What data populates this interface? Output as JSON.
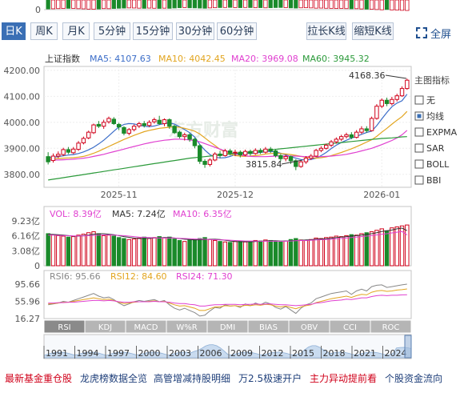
{
  "top_strip_label": "0",
  "tabs": [
    "日K",
    "周K",
    "月K",
    "5分钟",
    "15分钟",
    "30分钟",
    "60分钟"
  ],
  "buttons": {
    "stretch": "拉长K线",
    "shrink": "缩短K线",
    "fullscreen": "全屏"
  },
  "main": {
    "index_name": "上证指数",
    "ma": [
      {
        "label": "MA5: 4107.63",
        "color": "#3b6dc8"
      },
      {
        "label": "MA10: 4042.45",
        "color": "#e2a51f"
      },
      {
        "label": "MA20: 3969.08",
        "color": "#e040d0"
      },
      {
        "label": "MA60: 3945.32",
        "color": "#2b9a3a"
      }
    ],
    "y_ticks": [
      "4200.00",
      "4100.00",
      "4000.00",
      "3900.00",
      "3800.00"
    ],
    "x_ticks": [
      "2025-11",
      "2025-12",
      "2026-01"
    ],
    "high_label": "4168.36",
    "low_label": "3815.84",
    "watermark": "东方财富"
  },
  "indicators": {
    "title": "主图指标",
    "options": [
      {
        "label": "无",
        "checked": false
      },
      {
        "label": "均线",
        "checked": true
      },
      {
        "label": "EXPMA",
        "checked": false
      },
      {
        "label": "SAR",
        "checked": false
      },
      {
        "label": "BOLL",
        "checked": false
      },
      {
        "label": "BBI",
        "checked": false
      }
    ]
  },
  "volume": {
    "labels": [
      {
        "text": "VOL: 8.39亿",
        "color": "#e040d0"
      },
      {
        "text": "MA5: 7.24亿",
        "color": "#333333"
      },
      {
        "text": "MA10: 6.35亿",
        "color": "#e040d0"
      }
    ],
    "y_ticks": [
      "9.23亿",
      "6.16亿",
      "3.08亿",
      "0"
    ]
  },
  "rsi": {
    "labels": [
      {
        "text": "RSI6: 95.66",
        "color": "#888888"
      },
      {
        "text": "RSI12: 84.60",
        "color": "#e2a51f"
      },
      {
        "text": "RSI24: 71.30",
        "color": "#e040d0"
      }
    ],
    "y_ticks": [
      "95.66",
      "55.96",
      "16.27"
    ]
  },
  "indicator_tabs": [
    "RSI",
    "KDJ",
    "MACD",
    "W%R",
    "DMI",
    "BIAS",
    "OBV",
    "CCI",
    "ROC"
  ],
  "timeline_years": [
    "1991",
    "1994",
    "1997",
    "2000",
    "2003",
    "2006",
    "2009",
    "2012",
    "2015",
    "2018",
    "2021",
    "2024"
  ],
  "bottom_links": [
    {
      "label": "最新基金重仓股",
      "color": "#d0021b"
    },
    {
      "label": "龙虎榜数据全览",
      "color": "#1f3f7a"
    },
    {
      "label": "高管增减持股明细",
      "color": "#1f3f7a"
    },
    {
      "label": "万2.5极速开户",
      "color": "#1f3f7a"
    },
    {
      "label": "主力异动提前看",
      "color": "#d0021b"
    },
    {
      "label": "个股资金流向",
      "color": "#1f3f7a"
    }
  ],
  "colors": {
    "up": "#d0021b",
    "down": "#1a8a2a",
    "accent": "#3a6fb5"
  },
  "chart_data": {
    "type": "candlestick",
    "title": "上证指数",
    "ylim": [
      3750,
      4215
    ],
    "candles": [
      [
        3868,
        3848,
        3885,
        3838
      ],
      [
        3853,
        3870,
        3880,
        3845
      ],
      [
        3870,
        3877,
        3888,
        3862
      ],
      [
        3876,
        3895,
        3902,
        3870
      ],
      [
        3895,
        3885,
        3905,
        3878
      ],
      [
        3883,
        3897,
        3905,
        3878
      ],
      [
        3896,
        3920,
        3928,
        3890
      ],
      [
        3921,
        3938,
        3945,
        3915
      ],
      [
        3940,
        3962,
        3968,
        3935
      ],
      [
        3960,
        3990,
        3995,
        3955
      ],
      [
        3992,
        3985,
        4005,
        3978
      ],
      [
        3985,
        4000,
        4010,
        3975
      ],
      [
        4002,
        4015,
        4022,
        3995
      ],
      [
        4012,
        3995,
        4020,
        3990
      ],
      [
        3992,
        3982,
        3998,
        3970
      ],
      [
        3980,
        3958,
        3985,
        3950
      ],
      [
        3958,
        3972,
        3978,
        3950
      ],
      [
        3972,
        3985,
        3992,
        3965
      ],
      [
        3986,
        3995,
        4002,
        3978
      ],
      [
        3995,
        3988,
        4005,
        3980
      ],
      [
        3988,
        4000,
        4008,
        3982
      ],
      [
        4002,
        4010,
        4018,
        3995
      ],
      [
        4008,
        3995,
        4025,
        3990
      ],
      [
        3995,
        4010,
        4015,
        3985
      ],
      [
        4010,
        3985,
        4015,
        3975
      ],
      [
        3985,
        3960,
        3990,
        3955
      ],
      [
        3962,
        3945,
        3968,
        3938
      ],
      [
        3945,
        3952,
        3960,
        3930
      ],
      [
        3952,
        3935,
        3958,
        3925
      ],
      [
        3935,
        3910,
        3940,
        3900
      ],
      [
        3910,
        3850,
        3915,
        3840
      ],
      [
        3850,
        3838,
        3858,
        3825
      ],
      [
        3838,
        3855,
        3862,
        3830
      ],
      [
        3855,
        3878,
        3885,
        3850
      ],
      [
        3878,
        3872,
        3890,
        3862
      ],
      [
        3872,
        3890,
        3898,
        3868
      ],
      [
        3890,
        3882,
        3898,
        3872
      ],
      [
        3882,
        3885,
        3895,
        3870
      ],
      [
        3885,
        3875,
        3892,
        3865
      ],
      [
        3875,
        3888,
        3895,
        3870
      ],
      [
        3888,
        3880,
        3895,
        3872
      ],
      [
        3880,
        3892,
        3900,
        3875
      ],
      [
        3892,
        3885,
        3900,
        3878
      ],
      [
        3885,
        3897,
        3905,
        3880
      ],
      [
        3897,
        3890,
        3905,
        3882
      ],
      [
        3890,
        3872,
        3895,
        3865
      ],
      [
        3872,
        3860,
        3878,
        3850
      ],
      [
        3860,
        3868,
        3875,
        3850
      ],
      [
        3868,
        3852,
        3872,
        3840
      ],
      [
        3852,
        3830,
        3858,
        3816
      ],
      [
        3830,
        3848,
        3855,
        3825
      ],
      [
        3848,
        3862,
        3870,
        3840
      ],
      [
        3862,
        3870,
        3878,
        3855
      ],
      [
        3870,
        3892,
        3898,
        3865
      ],
      [
        3892,
        3900,
        3908,
        3885
      ],
      [
        3900,
        3912,
        3918,
        3895
      ],
      [
        3912,
        3925,
        3932,
        3905
      ],
      [
        3925,
        3935,
        3942,
        3918
      ],
      [
        3935,
        3945,
        3952,
        3928
      ],
      [
        3945,
        3952,
        3960,
        3938
      ],
      [
        3952,
        3942,
        3962,
        3935
      ],
      [
        3942,
        3962,
        3970,
        3938
      ],
      [
        3962,
        3975,
        3985,
        3955
      ],
      [
        3975,
        3968,
        3985,
        3960
      ],
      [
        3968,
        4015,
        4022,
        3965
      ],
      [
        4015,
        4062,
        4070,
        4010
      ],
      [
        4062,
        4085,
        4092,
        4055
      ],
      [
        4085,
        4072,
        4095,
        4062
      ],
      [
        4072,
        4088,
        4098,
        4065
      ],
      [
        4088,
        4102,
        4110,
        4080
      ],
      [
        4102,
        4130,
        4138,
        4098
      ],
      [
        4130,
        4162,
        4168,
        4125
      ]
    ],
    "ma_lines": {
      "MA5": [
        3865,
        3866,
        3868,
        3871,
        3874,
        3876,
        3880,
        3886,
        3894,
        3904,
        3917,
        3931,
        3948,
        3966,
        3982,
        3992,
        3995,
        3994,
        3989,
        3985,
        3983,
        3986,
        3991,
        3995,
        3998,
        3993,
        3983,
        3972,
        3960,
        3943,
        3915,
        3893,
        3876,
        3866,
        3863,
        3864,
        3869,
        3876,
        3878,
        3880,
        3881,
        3882,
        3884,
        3887,
        3888,
        3886,
        3881,
        3875,
        3868,
        3862,
        3857,
        3855,
        3857,
        3862,
        3872,
        3884,
        3899,
        3912,
        3922,
        3931,
        3939,
        3946,
        3954,
        3961,
        3966,
        3987,
        4013,
        4038,
        4060,
        4074,
        4083,
        4108
      ],
      "MA10": [
        3860,
        3860,
        3861,
        3862,
        3863,
        3864,
        3866,
        3869,
        3874,
        3881,
        3889,
        3898,
        3907,
        3916,
        3925,
        3934,
        3942,
        3950,
        3957,
        3964,
        3969,
        3973,
        3977,
        3979,
        3981,
        3983,
        3981,
        3977,
        3972,
        3966,
        3955,
        3940,
        3925,
        3911,
        3896,
        3886,
        3878,
        3872,
        3870,
        3869,
        3870,
        3872,
        3874,
        3878,
        3880,
        3881,
        3880,
        3878,
        3876,
        3873,
        3869,
        3866,
        3863,
        3862,
        3864,
        3867,
        3872,
        3878,
        3884,
        3891,
        3898,
        3906,
        3915,
        3924,
        3933,
        3946,
        3962,
        3977,
        3993,
        4008,
        4022,
        4042
      ],
      "MA20": [
        3855,
        3855,
        3855,
        3856,
        3857,
        3858,
        3860,
        3862,
        3865,
        3869,
        3873,
        3877,
        3882,
        3887,
        3892,
        3897,
        3902,
        3907,
        3912,
        3917,
        3921,
        3925,
        3928,
        3931,
        3933,
        3935,
        3935,
        3934,
        3932,
        3930,
        3925,
        3918,
        3911,
        3904,
        3897,
        3890,
        3884,
        3878,
        3874,
        3871,
        3869,
        3868,
        3868,
        3868,
        3869,
        3870,
        3870,
        3870,
        3870,
        3870,
        3869,
        3868,
        3868,
        3868,
        3868,
        3869,
        3870,
        3872,
        3874,
        3877,
        3881,
        3885,
        3890,
        3895,
        3900,
        3907,
        3914,
        3922,
        3930,
        3940,
        3952,
        3969
      ],
      "MA60": [
        3778,
        3781,
        3784,
        3787,
        3790,
        3793,
        3796,
        3799,
        3802,
        3805,
        3808,
        3811,
        3814,
        3817,
        3820,
        3823,
        3826,
        3829,
        3832,
        3835,
        3838,
        3841,
        3844,
        3847,
        3850,
        3853,
        3856,
        3859,
        3862,
        3864,
        3866,
        3868,
        3870,
        3872,
        3874,
        3876,
        3878,
        3880,
        3882,
        3884,
        3886,
        3888,
        3890,
        3892,
        3894,
        3896,
        3898,
        3900,
        3902,
        3904,
        3906,
        3908,
        3910,
        3912,
        3914,
        3916,
        3918,
        3920,
        3922,
        3924,
        3926,
        3928,
        3930,
        3932,
        3934,
        3936,
        3938,
        3939,
        3940,
        3942,
        3944,
        3945
      ]
    },
    "volume_ylim": [
      0,
      9.23
    ],
    "volume": [
      6.6,
      6.4,
      6.2,
      6.1,
      5.9,
      6.0,
      6.3,
      6.5,
      6.8,
      7.0,
      6.6,
      6.2,
      6.3,
      6.1,
      5.8,
      5.6,
      5.4,
      5.5,
      5.7,
      5.9,
      5.6,
      5.8,
      6.0,
      5.7,
      5.9,
      5.5,
      5.2,
      5.0,
      5.3,
      5.4,
      5.6,
      5.8,
      5.4,
      5.2,
      5.0,
      4.9,
      4.8,
      5.0,
      5.1,
      4.9,
      5.0,
      5.2,
      5.1,
      5.3,
      5.2,
      5.0,
      4.9,
      5.1,
      5.4,
      5.6,
      5.3,
      5.2,
      5.4,
      5.7,
      5.6,
      5.8,
      5.9,
      6.1,
      6.0,
      6.2,
      6.4,
      6.3,
      6.6,
      6.8,
      7.0,
      7.3,
      7.6,
      7.2,
      7.8,
      8.0,
      8.2,
      8.39
    ],
    "volume_ma": {
      "MA5": [
        6.5,
        6.45,
        6.4,
        6.3,
        6.2,
        6.1,
        6.1,
        6.2,
        6.3,
        6.5,
        6.6,
        6.6,
        6.5,
        6.4,
        6.2,
        6.0,
        5.85,
        5.7,
        5.6,
        5.6,
        5.65,
        5.7,
        5.75,
        5.8,
        5.8,
        5.7,
        5.6,
        5.45,
        5.4,
        5.3,
        5.35,
        5.4,
        5.45,
        5.45,
        5.4,
        5.25,
        5.1,
        5.0,
        4.95,
        4.95,
        4.95,
        5.0,
        5.05,
        5.1,
        5.15,
        5.15,
        5.1,
        5.1,
        5.15,
        5.2,
        5.25,
        5.3,
        5.35,
        5.45,
        5.5,
        5.55,
        5.65,
        5.8,
        5.9,
        6.0,
        6.1,
        6.2,
        6.3,
        6.45,
        6.6,
        6.8,
        7.05,
        7.2,
        7.35,
        7.6,
        7.75,
        7.24
      ],
      "MA10": [
        6.3,
        6.3,
        6.25,
        6.2,
        6.2,
        6.15,
        6.15,
        6.15,
        6.2,
        6.25,
        6.3,
        6.35,
        6.35,
        6.3,
        6.25,
        6.2,
        6.1,
        6.0,
        5.9,
        5.85,
        5.8,
        5.75,
        5.7,
        5.7,
        5.7,
        5.7,
        5.65,
        5.6,
        5.55,
        5.5,
        5.5,
        5.45,
        5.4,
        5.35,
        5.3,
        5.3,
        5.25,
        5.2,
        5.15,
        5.1,
        5.1,
        5.1,
        5.05,
        5.05,
        5.05,
        5.05,
        5.05,
        5.05,
        5.1,
        5.15,
        5.2,
        5.2,
        5.25,
        5.3,
        5.35,
        5.4,
        5.45,
        5.55,
        5.6,
        5.7,
        5.8,
        5.9,
        6.0,
        6.1,
        6.2,
        6.35,
        6.5,
        6.6,
        6.75,
        6.9,
        7.05,
        6.35
      ]
    },
    "rsi_ylim": [
      16.27,
      95.66
    ],
    "rsi_lines": {
      "RSI6": [
        48,
        50,
        52,
        56,
        54,
        58,
        62,
        66,
        70,
        74,
        68,
        64,
        66,
        60,
        52,
        46,
        50,
        55,
        58,
        56,
        58,
        60,
        55,
        58,
        48,
        40,
        36,
        40,
        35,
        30,
        22,
        24,
        34,
        42,
        40,
        48,
        45,
        46,
        42,
        50,
        46,
        52,
        48,
        54,
        50,
        42,
        38,
        44,
        36,
        28,
        40,
        48,
        52,
        62,
        66,
        70,
        74,
        76,
        78,
        80,
        72,
        80,
        84,
        80,
        90,
        93,
        94,
        88,
        90,
        92,
        94,
        95.66
      ],
      "RSI12": [
        50,
        51,
        52,
        54,
        54,
        56,
        58,
        60,
        62,
        64,
        62,
        60,
        61,
        58,
        54,
        51,
        52,
        54,
        55,
        55,
        56,
        57,
        55,
        56,
        52,
        48,
        45,
        46,
        43,
        40,
        35,
        35,
        39,
        43,
        43,
        46,
        45,
        46,
        44,
        47,
        46,
        48,
        47,
        49,
        48,
        45,
        43,
        45,
        42,
        39,
        43,
        46,
        48,
        53,
        56,
        59,
        62,
        64,
        66,
        68,
        65,
        69,
        72,
        71,
        77,
        80,
        81,
        79,
        80,
        82,
        83,
        84.6
      ],
      "RSI24": [
        52,
        52,
        53,
        53,
        54,
        54,
        55,
        56,
        57,
        58,
        58,
        57,
        58,
        57,
        55,
        54,
        54,
        55,
        55,
        55,
        55,
        56,
        55,
        55,
        54,
        52,
        51,
        51,
        49,
        48,
        45,
        45,
        47,
        48,
        48,
        49,
        49,
        49,
        48,
        49,
        49,
        50,
        49,
        50,
        50,
        49,
        48,
        48,
        47,
        46,
        47,
        48,
        49,
        52,
        53,
        55,
        57,
        58,
        59,
        61,
        60,
        62,
        64,
        64,
        67,
        69,
        70,
        69,
        70,
        70,
        71,
        71.3
      ]
    }
  }
}
